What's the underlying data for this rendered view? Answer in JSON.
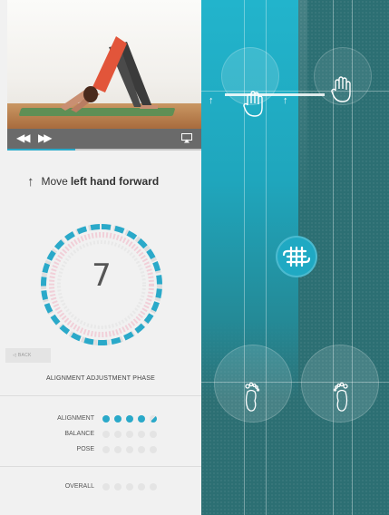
{
  "instruction": {
    "prefix": "Move",
    "emphasis": "left hand forward"
  },
  "counter": {
    "value": "7"
  },
  "back_button": {
    "label": "BACK"
  },
  "phase": {
    "title": "ALIGNMENT ADJUSTMENT PHASE"
  },
  "metrics": [
    {
      "label": "ALIGNMENT",
      "filled": 4,
      "partial": 1,
      "total": 5
    },
    {
      "label": "BALANCE",
      "filled": 0,
      "partial": 0,
      "total": 5
    },
    {
      "label": "POSE",
      "filled": 0,
      "partial": 0,
      "total": 5
    }
  ],
  "overall": {
    "label": "OVERALL",
    "filled": 0,
    "partial": 0,
    "total": 5
  },
  "video": {
    "progress": 0.35
  },
  "icons": {
    "rewind": "rewind-icon",
    "forward": "fast-forward-icon",
    "airplay": "airplay-icon",
    "hand": "hand-icon",
    "foot": "foot-icon",
    "center": "celtic-knot-icon"
  },
  "colors": {
    "accent": "#2aa9c9",
    "dark_teal": "#2c6f73",
    "cyan": "#22b4cc",
    "inactive_dot": "#e4e4e4"
  }
}
